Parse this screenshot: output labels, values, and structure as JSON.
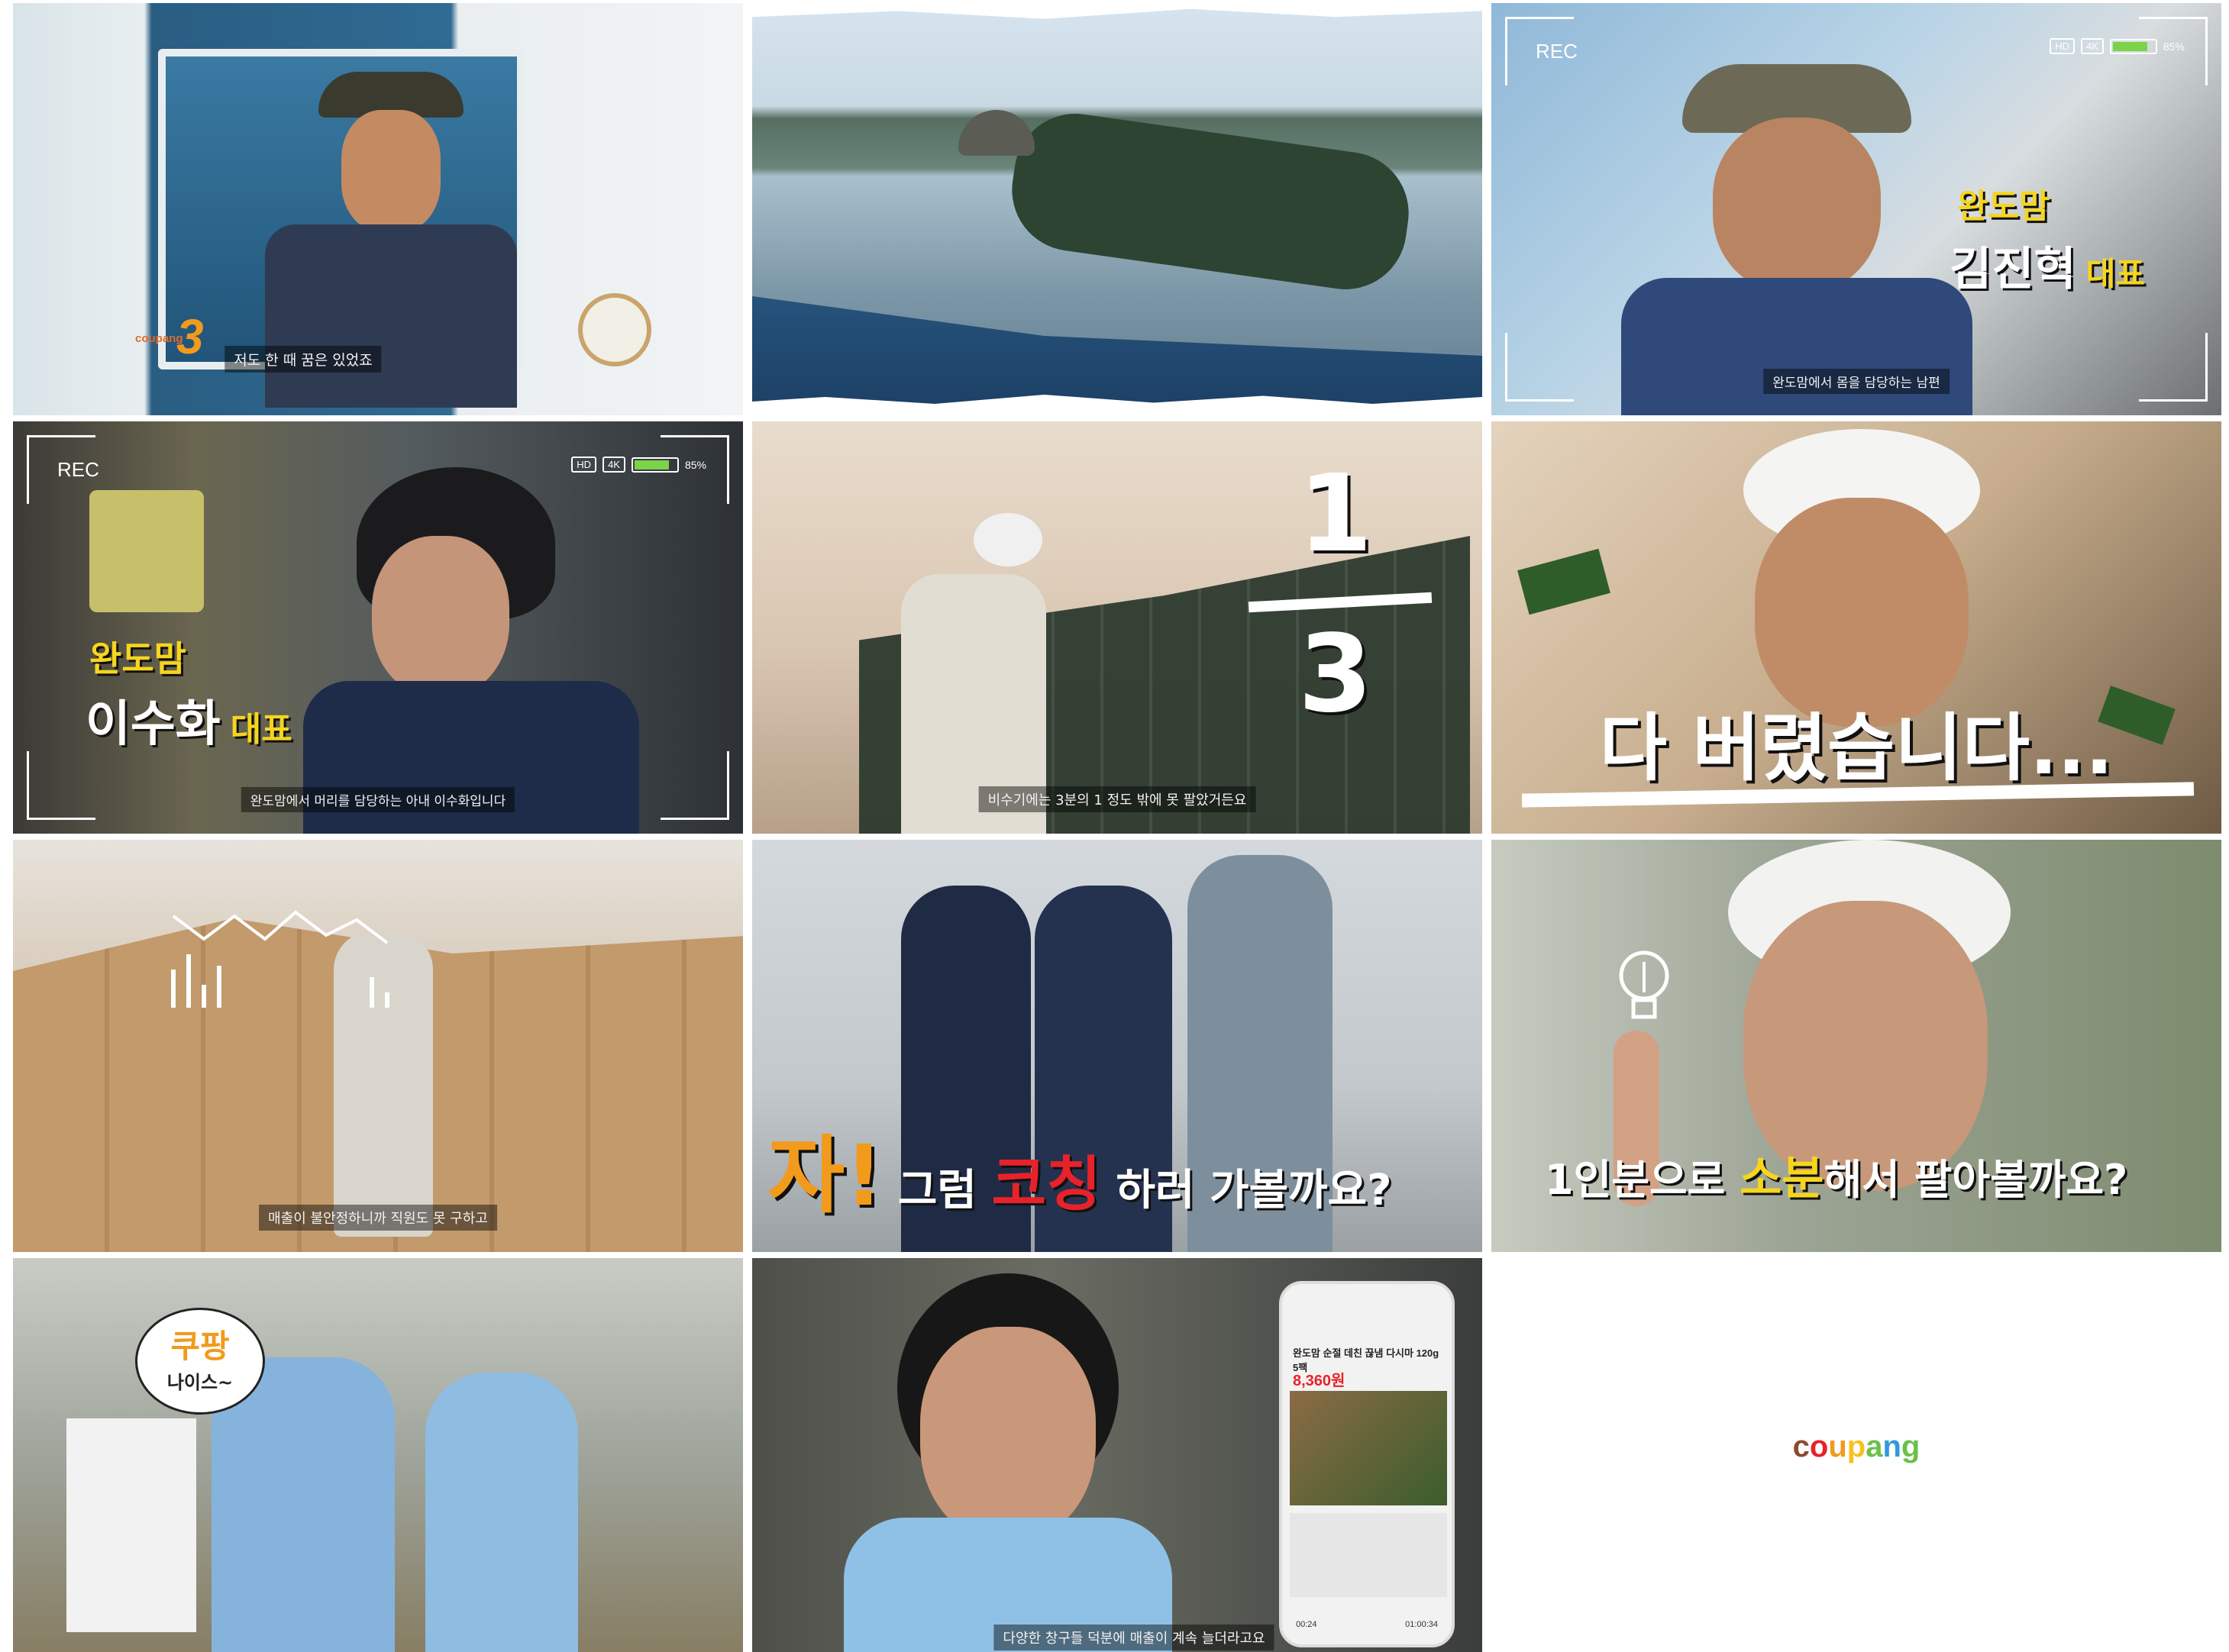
{
  "frames": {
    "f1": {
      "subtitle": "저도 한 때 꿈은 있었죠",
      "badge_brand": "coupang",
      "badge_number": "3"
    },
    "f3": {
      "rec": "REC",
      "hd": "HD",
      "k4": "4K",
      "battery": "85%",
      "battery_level": 0.85,
      "name_top": "완도맘",
      "name_main": "김진혁",
      "name_title": "대표",
      "subtitle": "완도맘에서 몸을 담당하는 남편"
    },
    "f4": {
      "rec": "REC",
      "hd": "HD",
      "k4": "4K",
      "battery": "85%",
      "battery_level": 0.85,
      "name_top": "완도맘",
      "name_main": "이수화",
      "name_title": "대표",
      "subtitle": "완도맘에서 머리를 담당하는 아내 이수화입니다"
    },
    "f5": {
      "fraction_top": "1",
      "fraction_bottom": "3",
      "subtitle": "비수기에는 3분의 1 정도 밖에 못 팔았거든요"
    },
    "f6": {
      "caption": "다 버렸습니다..."
    },
    "f7": {
      "subtitle": "매출이 불안정하니까 직원도 못 구하고"
    },
    "f8": {
      "cap_ja": "자!",
      "cap_a": " 그럼 ",
      "cap_coaching": "코칭",
      "cap_b": " 하러 가볼까요?"
    },
    "f9": {
      "cap_a": "1인분으로 ",
      "cap_sobun": "소분",
      "cap_b": "해서 팔아볼까요?"
    },
    "f10": {
      "bubble_top": "쿠팡",
      "bubble_bottom": "나이스~"
    },
    "f11": {
      "subtitle": "다양한 창구들 덕분에 매출이 계속 늘더라고요",
      "phone_price": "8,360원",
      "phone_title": "완도맘 순절 데친 끊냄 다시마 120g 5팩",
      "phone_time_a": "00:24",
      "phone_time_b": "01:00:34"
    },
    "f12": {
      "logo": "coupang"
    }
  },
  "colors": {
    "brand_yellow": "#f6d51e",
    "brand_red": "#e8222a",
    "brand_orange": "#f29a1c",
    "coupang_green": "#6cc04a"
  }
}
